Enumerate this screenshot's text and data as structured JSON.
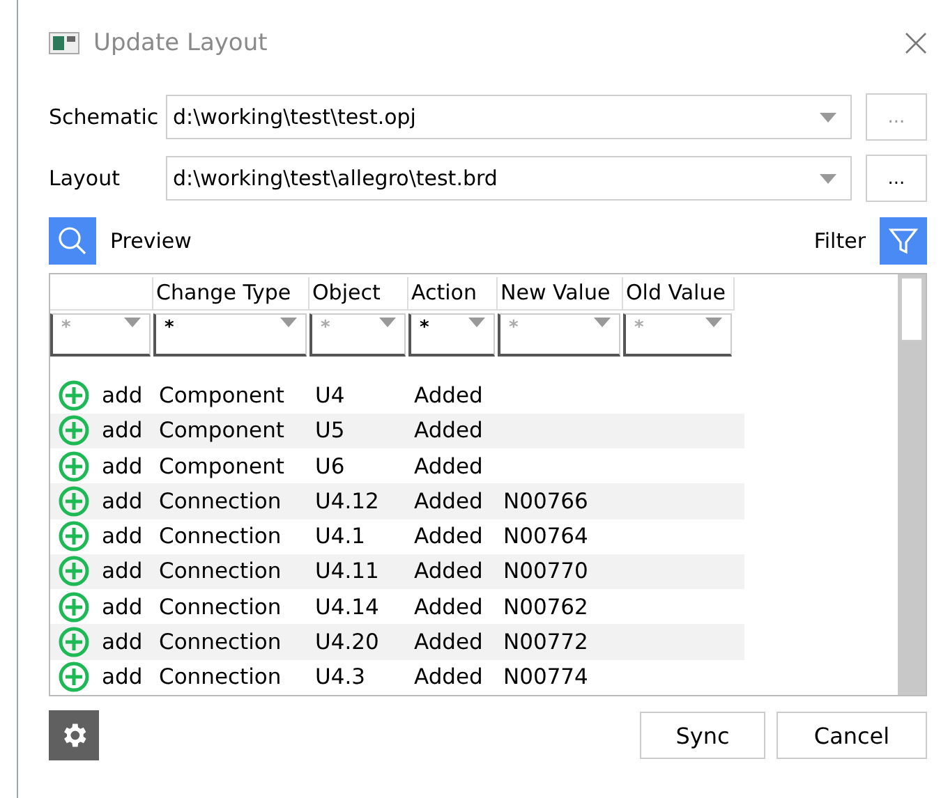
{
  "window": {
    "title": "Update Layout"
  },
  "fields": [
    {
      "label": "Schematic",
      "value": "d:\\working\\test\\test.opj",
      "browse": "...",
      "browse_enabled": false
    },
    {
      "label": "Layout",
      "value": "d:\\working\\test\\allegro\\test.brd",
      "browse": "...",
      "browse_enabled": true
    }
  ],
  "preview": {
    "label": "Preview"
  },
  "filter": {
    "label": "Filter"
  },
  "table": {
    "columns": [
      "Change Type",
      "Object",
      "Action",
      "New Value",
      "Old Value"
    ],
    "filters": [
      {
        "value": "*",
        "active": false
      },
      {
        "value": "*",
        "active": true
      },
      {
        "value": "*",
        "active": false
      },
      {
        "value": "*",
        "active": true
      },
      {
        "value": "*",
        "active": false
      },
      {
        "value": "*",
        "active": false
      }
    ],
    "rows": [
      {
        "change": "add",
        "type": "Component",
        "object": "U4",
        "action": "Added"
      },
      {
        "change": "add",
        "type": "Component",
        "object": "U5",
        "action": "Added"
      },
      {
        "change": "add",
        "type": "Component",
        "object": "U6",
        "action": "Added"
      },
      {
        "change": "add",
        "type": "Connection",
        "object": "U4.12",
        "action": "Added",
        "new_value": "N00766"
      },
      {
        "change": "add",
        "type": "Connection",
        "object": "U4.1",
        "action": "Added",
        "new_value": "N00764"
      },
      {
        "change": "add",
        "type": "Connection",
        "object": "U4.11",
        "action": "Added",
        "new_value": "N00770"
      },
      {
        "change": "add",
        "type": "Connection",
        "object": "U4.14",
        "action": "Added",
        "new_value": "N00762"
      },
      {
        "change": "add",
        "type": "Connection",
        "object": "U4.20",
        "action": "Added",
        "new_value": "N00772"
      },
      {
        "change": "add",
        "type": "Connection",
        "object": "U4.3",
        "action": "Added",
        "new_value": "N00774"
      }
    ]
  },
  "buttons": [
    "Sync",
    "Cancel"
  ]
}
